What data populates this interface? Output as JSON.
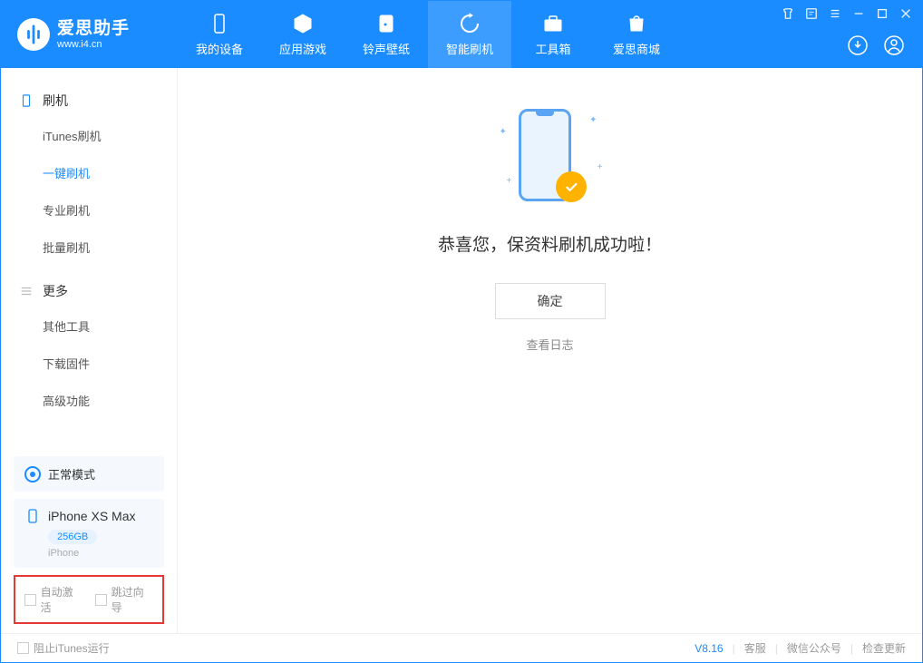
{
  "app": {
    "name": "爱思助手",
    "url": "www.i4.cn"
  },
  "nav": {
    "items": [
      {
        "label": "我的设备",
        "icon": "phone"
      },
      {
        "label": "应用游戏",
        "icon": "cube"
      },
      {
        "label": "铃声壁纸",
        "icon": "music"
      },
      {
        "label": "智能刷机",
        "icon": "refresh",
        "active": true
      },
      {
        "label": "工具箱",
        "icon": "toolbox"
      },
      {
        "label": "爱思商城",
        "icon": "bag"
      }
    ]
  },
  "sidebar": {
    "section1": {
      "title": "刷机"
    },
    "items1": [
      {
        "label": "iTunes刷机"
      },
      {
        "label": "一键刷机",
        "active": true
      },
      {
        "label": "专业刷机"
      },
      {
        "label": "批量刷机"
      }
    ],
    "section2": {
      "title": "更多"
    },
    "items2": [
      {
        "label": "其他工具"
      },
      {
        "label": "下载固件"
      },
      {
        "label": "高级功能"
      }
    ],
    "mode": "正常模式",
    "device": {
      "name": "iPhone XS Max",
      "storage": "256GB",
      "type": "iPhone"
    },
    "checkboxes": {
      "auto_activate": "自动激活",
      "skip_guide": "跳过向导"
    }
  },
  "main": {
    "success_text": "恭喜您，保资料刷机成功啦！",
    "ok_button": "确定",
    "view_log": "查看日志"
  },
  "footer": {
    "block_itunes": "阻止iTunes运行",
    "version": "V8.16",
    "links": {
      "service": "客服",
      "wechat": "微信公众号",
      "update": "检查更新"
    }
  }
}
